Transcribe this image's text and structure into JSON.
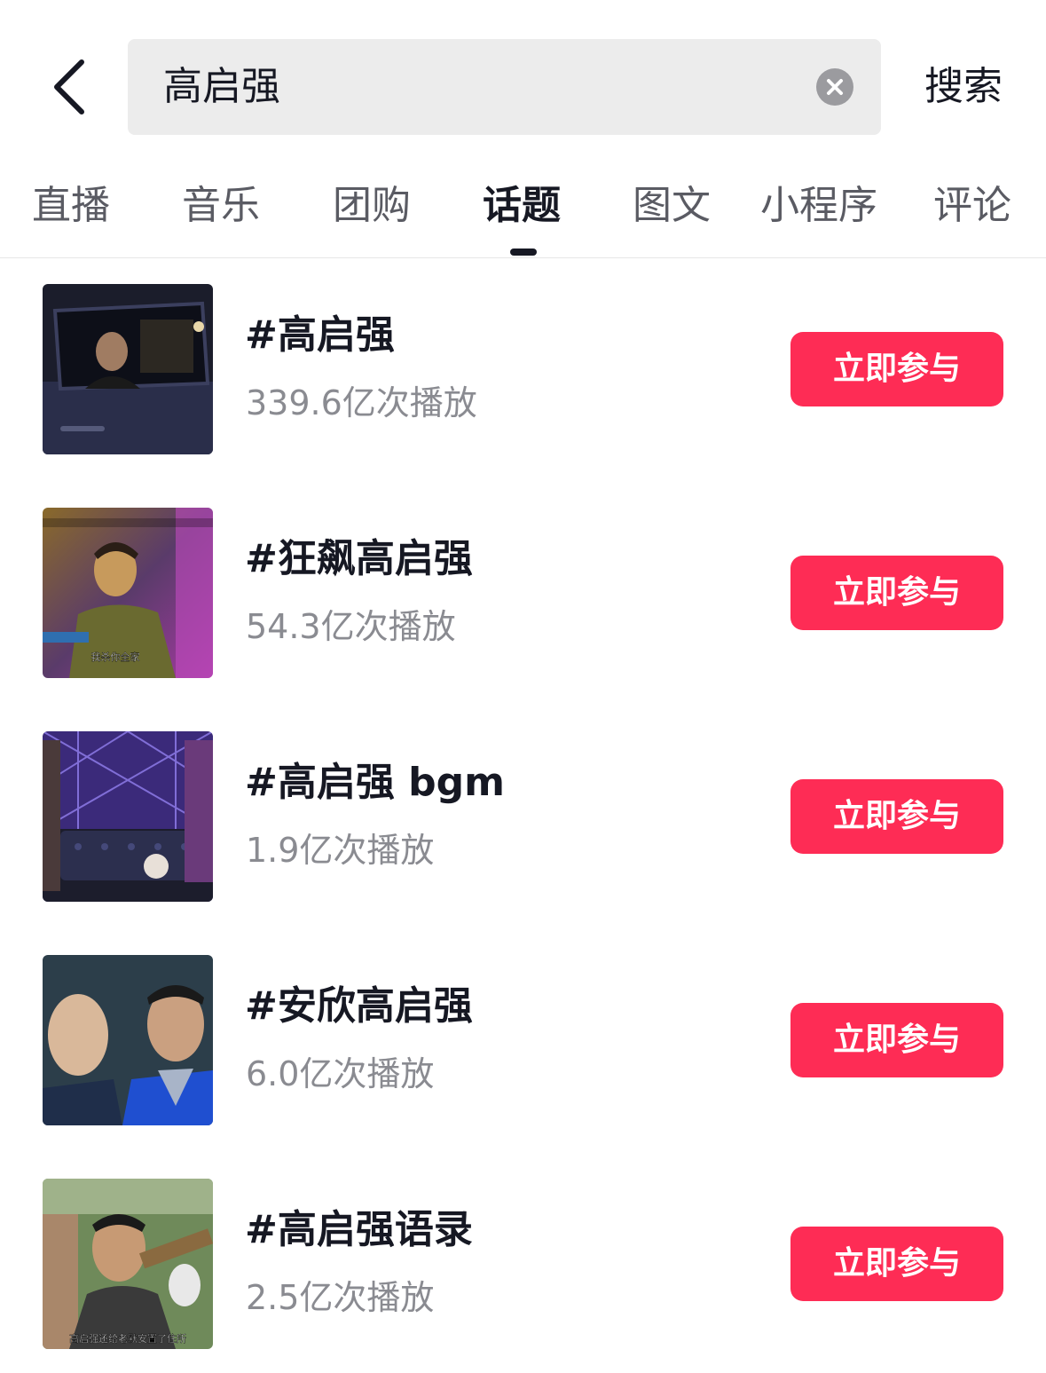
{
  "search": {
    "query": "高启强",
    "submit_label": "搜索"
  },
  "tabs": [
    {
      "label": "直播"
    },
    {
      "label": "音乐"
    },
    {
      "label": "团购"
    },
    {
      "label": "话题",
      "active": true
    },
    {
      "label": "图文"
    },
    {
      "label": "小程序"
    },
    {
      "label": "评论"
    }
  ],
  "topics": [
    {
      "title": "#高启强",
      "plays": "339.6亿次播放",
      "button": "立即参与",
      "thumb_caption": ""
    },
    {
      "title": "#狂飙高启强",
      "plays": "54.3亿次播放",
      "button": "立即参与",
      "thumb_caption": "我杀你全家"
    },
    {
      "title": "#高启强 bgm",
      "plays": "1.9亿次播放",
      "button": "立即参与",
      "thumb_caption": ""
    },
    {
      "title": "#安欣高启强",
      "plays": "6.0亿次播放",
      "button": "立即参与",
      "thumb_caption": ""
    },
    {
      "title": "#高启强语录",
      "plays": "2.5亿次播放",
      "button": "立即参与",
      "thumb_caption": "高启强还给老默安置了住所"
    }
  ],
  "colors": {
    "accent": "#fe2c55",
    "text_primary": "#161823",
    "text_secondary": "#8a8b91",
    "search_bg": "#ececec"
  }
}
